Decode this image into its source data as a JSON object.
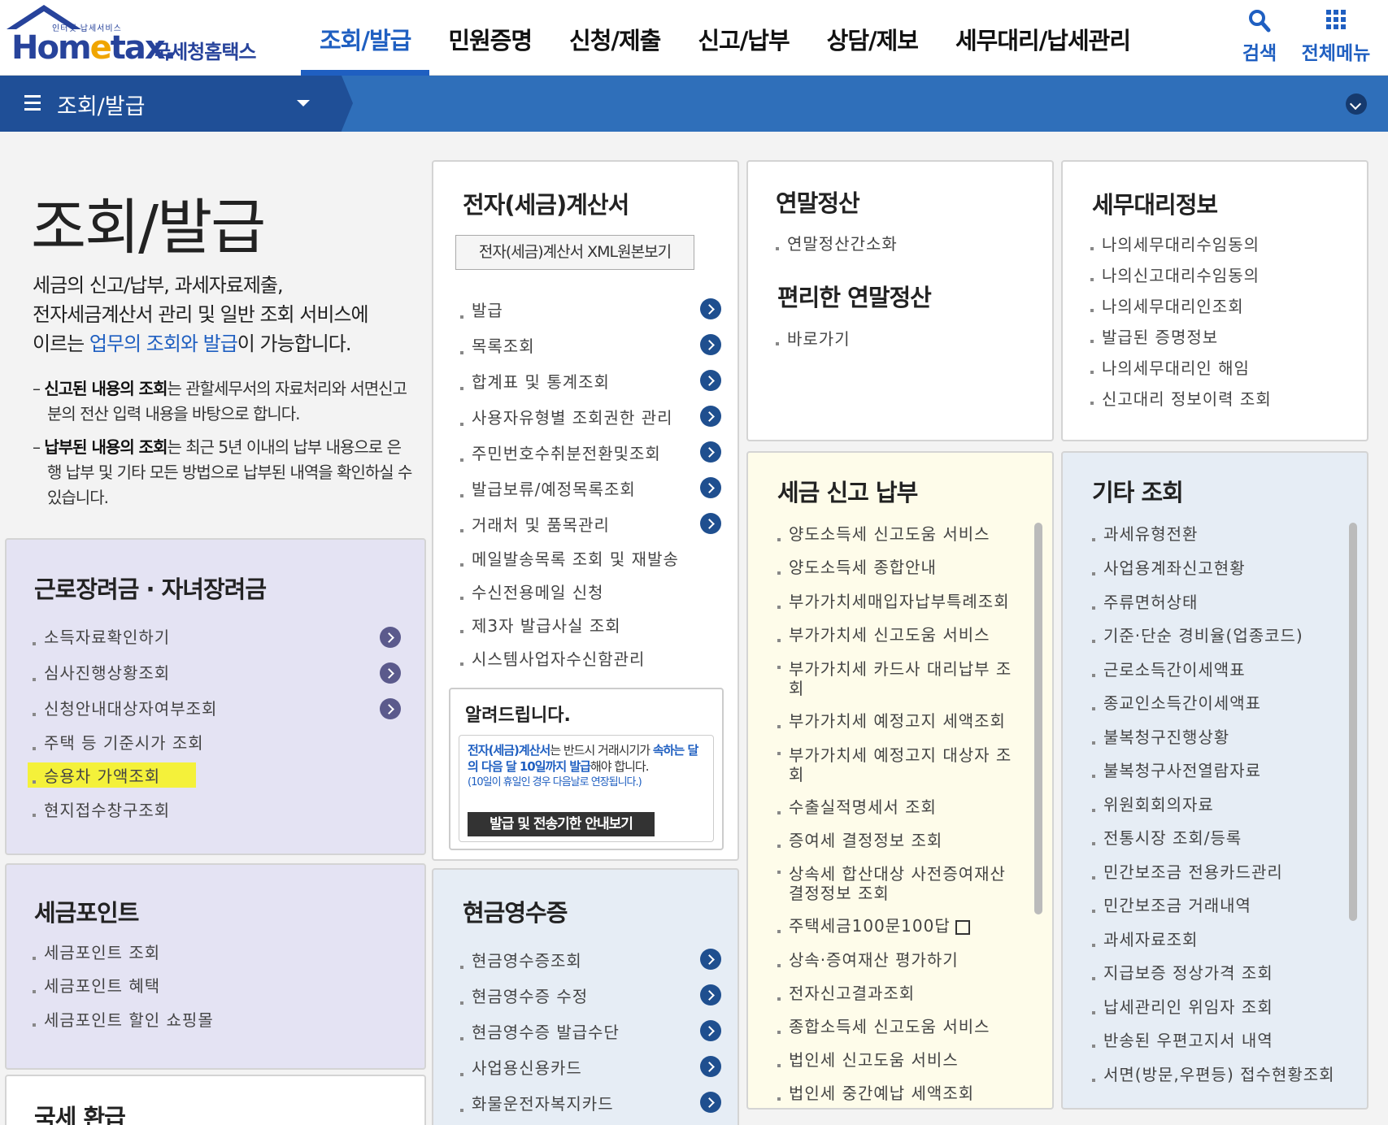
{
  "header": {
    "logo_small": "인터넷 납세서비스",
    "logo_main_a": "Hom",
    "logo_main_e": "e",
    "logo_main_b": "tax.",
    "logo_sub": "국세청홈택스",
    "nav": [
      "조회/발급",
      "민원증명",
      "신청/제출",
      "신고/납부",
      "상담/제보",
      "세무대리/납세관리"
    ],
    "search_label": "검색",
    "menu_label": "전체메뉴"
  },
  "subbar": {
    "title": "조회/발급"
  },
  "intro": {
    "title": "조회/발급",
    "line1": "세금의 신고/납부, 과세자료제출,",
    "line2": "전자세금계산서 관리 및 일반 조회 서비스에",
    "line3_a": "이르는 ",
    "line3_hl": "업무의 조회와 발급",
    "line3_b": "이 가능합니다.",
    "note1_b": "신고된 내용의 조회",
    "note1_t": "는 관할세무서의 자료처리와 서면신고분의 전산 입력 내용을 바탕으로 합니다.",
    "note2_b": "납부된 내용의 조회",
    "note2_t": "는 최근 5년 이내의 납부 내용으로 은행 납부 및 기타 모든 방법으로 납부된 내역을 확인하실 수 있습니다."
  },
  "einvoice": {
    "title": "전자(세금)계산서",
    "xml_button": "전자(세금)계산서 XML원본보기",
    "items": [
      "발급",
      "목록조회",
      "합계표 및 통계조회",
      "사용자유형별 조회권한 관리",
      "주민번호수취분전환및조회",
      "발급보류/예정목록조회",
      "거래처 및 품목관리",
      "메일발송목록 조회 및 재발송",
      "수신전용메일 신청",
      "제3자 발급사실 조회",
      "시스템사업자수신함관리"
    ],
    "notice_title": "알려드립니다.",
    "notice_b1": "전자(세금)계산서",
    "notice_t1": "는 반드시 거래시기가 ",
    "notice_b2": "속하는 달의 다음 달 10일까지 발급",
    "notice_t2": "해야 합니다.",
    "notice_small": "(10일이 휴일인 경우 다음날로 연장됩니다.)",
    "notice_button": "발급 및 전송기한 안내보기"
  },
  "yearend": {
    "title": "연말정산",
    "items": [
      "연말정산간소화"
    ],
    "title2": "편리한 연말정산",
    "items2": [
      "바로가기"
    ]
  },
  "agent": {
    "title": "세무대리정보",
    "items": [
      "나의세무대리수임동의",
      "나의신고대리수임동의",
      "나의세무대리인조회",
      "발급된 증명정보",
      "나의세무대리인 해임",
      "신고대리 정보이력 조회"
    ]
  },
  "labor": {
    "title": "근로장려금 · 자녀장려금",
    "items": [
      "소득자료확인하기",
      "심사진행상황조회",
      "신청안내대상자여부조회",
      "주택 등 기준시가 조회",
      "승용차 가액조회",
      "현지접수창구조회"
    ]
  },
  "taxpoint": {
    "title": "세금포인트",
    "items": [
      "세금포인트 조회",
      "세금포인트 혜택",
      "세금포인트 할인 쇼핑몰"
    ]
  },
  "refund": {
    "title": "국세 환급"
  },
  "cash": {
    "title": "현금영수증",
    "items": [
      "현금영수증조회",
      "현금영수증 수정",
      "현금영수증 발급수단",
      "사업용신용카드",
      "화물운전자복지카드"
    ]
  },
  "filing": {
    "title": "세금 신고 납부",
    "items": [
      "양도소득세 신고도움 서비스",
      "양도소득세 종합안내",
      "부가가치세매입자납부특례조회",
      "부가가치세 신고도움 서비스",
      "부가가치세 카드사 대리납부 조",
      "회",
      "부가가치세 예정고지 세액조회",
      "부가가치세 예정고지 대상자 조",
      "회",
      "수출실적명세서 조회",
      "증여세 결정정보 조회",
      "상속세 합산대상 사전증여재산",
      "결정정보 조회",
      "주택세금100문100답",
      "상속·증여재산 평가하기",
      "전자신고결과조회",
      "종합소득세 신고도움 서비스",
      "법인세 신고도움 서비스",
      "법인세 중간예납 세액조회"
    ]
  },
  "other": {
    "title": "기타 조회",
    "items": [
      "과세유형전환",
      "사업용계좌신고현황",
      "주류면허상태",
      "기준·단순 경비율(업종코드)",
      "근로소득간이세액표",
      "종교인소득간이세액표",
      "불복청구진행상황",
      "불복청구사전열람자료",
      "위원회회의자료",
      "전통시장 조회/등록",
      "민간보조금 전용카드관리",
      "민간보조금 거래내역",
      "과세자료조회",
      "지급보증 정상가격 조회",
      "납세관리인 위임자 조회",
      "반송된 우편고지서 내역",
      "서면(방문,우편등) 접수현황조회"
    ]
  },
  "colors": {
    "accent": "#1f5fc1",
    "subbar": "#2f6fba",
    "highlight": "#f4f13a"
  },
  "icons": [
    "search-icon",
    "grid-menu-icon",
    "hamburger-icon",
    "chevron-down-icon",
    "arrow-right-icon",
    "external-link-icon"
  ]
}
